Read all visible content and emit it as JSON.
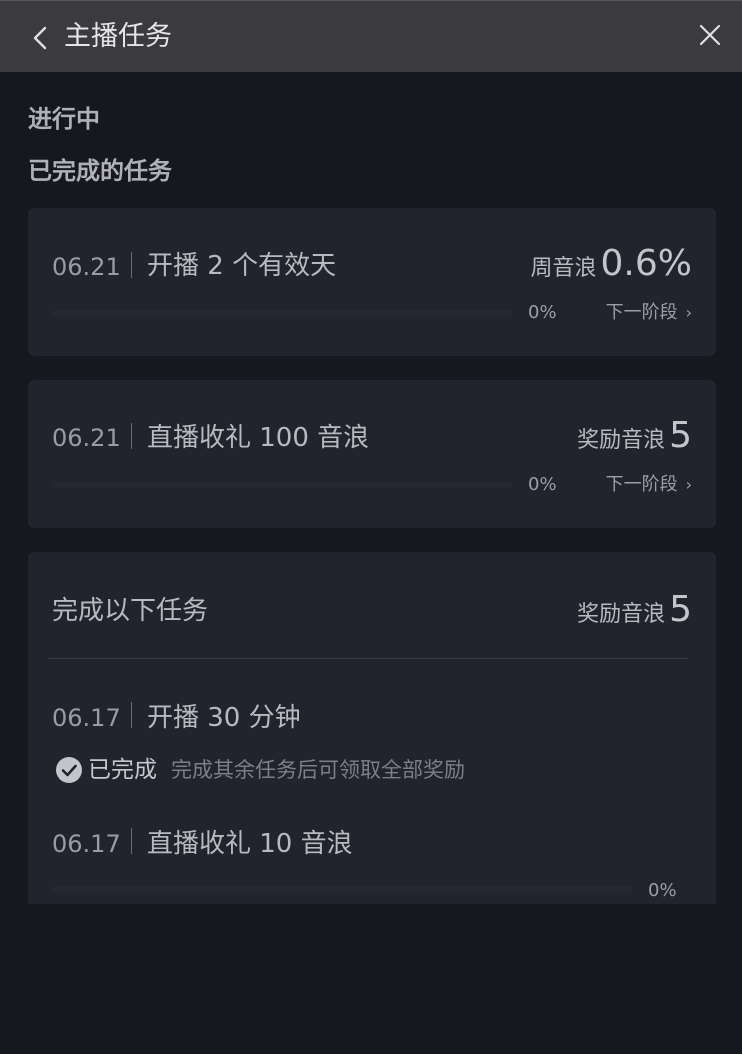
{
  "header": {
    "title": "主播任务"
  },
  "sections": {
    "in_progress": "进行中",
    "completed": "已完成的任务"
  },
  "tasks": [
    {
      "date": "06.21",
      "name": "开播 2 个有效天",
      "reward_label": "周音浪",
      "reward_value": "0.6%",
      "progress_text": "0%",
      "progress": 0,
      "next_label": "下一阶段"
    },
    {
      "date": "06.21",
      "name": "直播收礼 100 音浪",
      "reward_label": "奖励音浪",
      "reward_value": "5",
      "progress_text": "0%",
      "progress": 0,
      "next_label": "下一阶段"
    }
  ],
  "group": {
    "title": "完成以下任务",
    "reward_label": "奖励音浪",
    "reward_value": "5",
    "subtasks": [
      {
        "date": "06.17",
        "name": "开播 30 分钟",
        "status": "已完成",
        "hint": "完成其余任务后可领取全部奖励"
      },
      {
        "date": "06.17",
        "name": "直播收礼 10 音浪",
        "progress_text": "0%",
        "progress": 0
      }
    ]
  },
  "colors": {
    "background": "#17181f",
    "card": "#22232d",
    "titlebar": "#3b3b3d"
  },
  "icons": {
    "back": "chevron-left-icon",
    "close": "close-icon",
    "check": "check-circle-icon",
    "next": "chevron-right-icon"
  }
}
